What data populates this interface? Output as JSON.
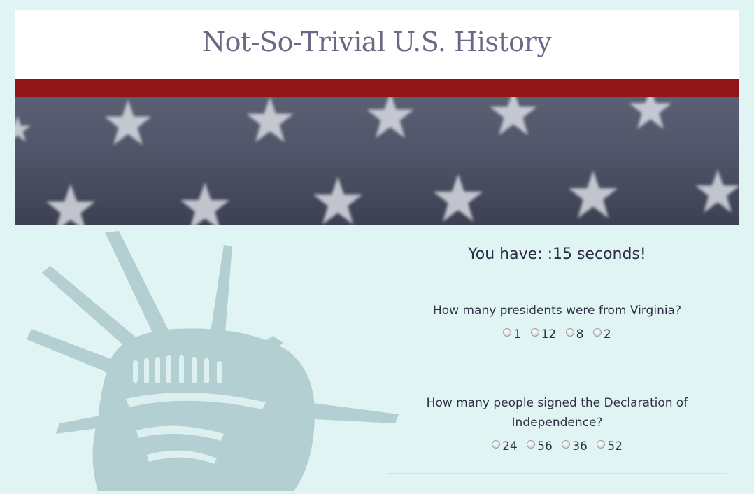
{
  "header": {
    "title": "Not-So-Trivial U.S. History"
  },
  "colors": {
    "page_bg": "#e1f4f4",
    "accent_red": "#8f1519",
    "title": "#6b6a86"
  },
  "quiz": {
    "timer_text": "You have: :15 seconds!",
    "questions": [
      {
        "text": "How many presidents were from Virginia?",
        "options": [
          "1",
          "12",
          "8",
          "2"
        ]
      },
      {
        "text": "How many people signed the Declaration of Independence?",
        "options": [
          "24",
          "56",
          "36",
          "52"
        ]
      }
    ]
  }
}
